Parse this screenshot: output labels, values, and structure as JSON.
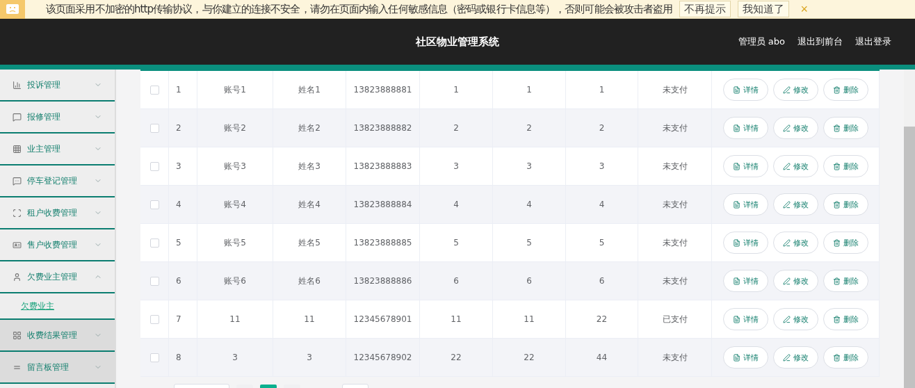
{
  "notice_bar": {
    "message": "该页面采用不加密的http传输协议，与你建立的连接不安全，请勿在页面内输入任何敏感信息（密码或银行卡信息等），否则可能会被攻击者盗用",
    "buttons": [
      "不再提示",
      "我知道了"
    ],
    "close": "×"
  },
  "header": {
    "title": "社区物业管理系统",
    "links": [
      "管理员 abo",
      "退出到前台",
      "退出登录"
    ]
  },
  "sidebar": {
    "items": [
      {
        "label": "投诉管理",
        "expanded": false,
        "highlighted": false
      },
      {
        "label": "报修管理",
        "expanded": false,
        "highlighted": false
      },
      {
        "label": "业主管理",
        "expanded": false,
        "highlighted": false
      },
      {
        "label": "停车登记管理",
        "expanded": false,
        "highlighted": false
      },
      {
        "label": "租户收费管理",
        "expanded": false,
        "highlighted": false
      },
      {
        "label": "售户收费管理",
        "expanded": false,
        "highlighted": false
      },
      {
        "label": "欠费业主管理",
        "expanded": true,
        "highlighted": false,
        "children": [
          {
            "label": "欠费业主",
            "selected": true
          }
        ]
      },
      {
        "label": "收费结果管理",
        "expanded": false,
        "highlighted": true
      },
      {
        "label": "留言板管理",
        "expanded": false,
        "highlighted": true
      }
    ]
  },
  "table": {
    "rows": [
      {
        "checked": false,
        "cells": [
          "1",
          "账号1",
          "姓名1",
          "13823888881",
          "1",
          "1",
          "1",
          "未支付"
        ],
        "actions": [
          "详情",
          "修改",
          "删除"
        ]
      },
      {
        "checked": false,
        "cells": [
          "2",
          "账号2",
          "姓名2",
          "13823888882",
          "2",
          "2",
          "2",
          "未支付"
        ],
        "actions": [
          "详情",
          "修改",
          "删除"
        ]
      },
      {
        "checked": false,
        "cells": [
          "3",
          "账号3",
          "姓名3",
          "13823888883",
          "3",
          "3",
          "3",
          "未支付"
        ],
        "actions": [
          "详情",
          "修改",
          "删除"
        ]
      },
      {
        "checked": false,
        "cells": [
          "4",
          "账号4",
          "姓名4",
          "13823888884",
          "4",
          "4",
          "4",
          "未支付"
        ],
        "actions": [
          "详情",
          "修改",
          "删除"
        ]
      },
      {
        "checked": false,
        "cells": [
          "5",
          "账号5",
          "姓名5",
          "13823888885",
          "5",
          "5",
          "5",
          "未支付"
        ],
        "actions": [
          "详情",
          "修改",
          "删除"
        ]
      },
      {
        "checked": false,
        "cells": [
          "6",
          "账号6",
          "姓名6",
          "13823888886",
          "6",
          "6",
          "6",
          "未支付"
        ],
        "actions": [
          "详情",
          "修改",
          "删除"
        ]
      },
      {
        "checked": false,
        "cells": [
          "7",
          "11",
          "11",
          "12345678901",
          "11",
          "11",
          "22",
          "已支付"
        ],
        "actions": [
          "详情",
          "修改",
          "删除"
        ]
      },
      {
        "checked": false,
        "cells": [
          "8",
          "3",
          "3",
          "12345678902",
          "22",
          "22",
          "44",
          "未支付"
        ],
        "actions": [
          "详情",
          "修改",
          "删除"
        ]
      }
    ]
  },
  "pagination": {
    "pages": [
      {
        "selected": false
      },
      {
        "selected": true
      },
      {
        "selected": false
      }
    ]
  }
}
